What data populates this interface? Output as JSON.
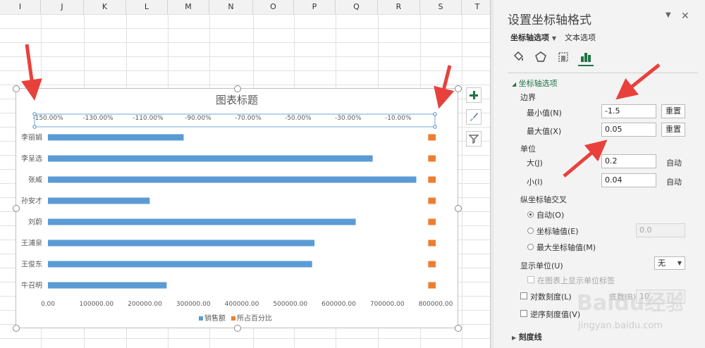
{
  "sheet": {
    "columns": [
      "I",
      "J",
      "K",
      "L",
      "M",
      "N",
      "O",
      "P",
      "Q",
      "R",
      "S",
      "T"
    ]
  },
  "chart": {
    "colors": {
      "sales": "#5b9bd5",
      "percent": "#ed7d31"
    }
  },
  "chart_data": {
    "type": "bar",
    "title": "图表标题",
    "categories": [
      "李丽娟",
      "李呈选",
      "张威",
      "孙安才",
      "刘蔚",
      "王浦泉",
      "王俊东",
      "牛召明"
    ],
    "series": [
      {
        "name": "销售额",
        "axis": "bottom",
        "values": [
          280000,
          670000,
          760000,
          210000,
          635000,
          550000,
          545000,
          245000
        ]
      },
      {
        "name": "所占百分比",
        "axis": "top",
        "values": [
          0.03,
          0.03,
          0.03,
          0.03,
          0.03,
          0.03,
          0.03,
          0.03
        ]
      }
    ],
    "bottom_axis": {
      "range": [
        0,
        800000
      ],
      "tick_labels": [
        "0.00",
        "100000.00",
        "200000.00",
        "300000.00",
        "400000.00",
        "500000.00",
        "600000.00",
        "700000.00",
        "800000.00"
      ]
    },
    "top_axis": {
      "range": [
        -1.5,
        0.05
      ],
      "tick_labels": [
        "-150.00%",
        "-130.00%",
        "-110.00%",
        "-90.00%",
        "-70.00%",
        "-50.00%",
        "-30.00%",
        "-10.00%"
      ]
    },
    "legend_position": "bottom",
    "legend": [
      "销售额",
      "所占百分比"
    ],
    "grid": false
  },
  "pane": {
    "title": "设置坐标轴格式",
    "tabs": {
      "axis_options": "坐标轴选项",
      "text_options": "文本选项"
    },
    "section": "坐标轴选项",
    "bounds": {
      "label": "边界",
      "min_label": "最小值(N)",
      "min_value": "-1.5",
      "max_label": "最大值(X)",
      "max_value": "0.05",
      "reset": "重置"
    },
    "units": {
      "label": "单位",
      "major_label": "大(J)",
      "major_value": "0.2",
      "minor_label": "小(I)",
      "minor_value": "0.04",
      "auto": "自动"
    },
    "cross": {
      "label": "纵坐标轴交叉",
      "auto": "自动(O)",
      "axis_value": "坐标轴值(E)",
      "axis_value_input": "0.0",
      "max_value": "最大坐标轴值(M)"
    },
    "display_units": {
      "label": "显示单位(U)",
      "value": "无",
      "show_label": "在图表上显示单位标签"
    },
    "log_scale_label": "对数刻度(L)",
    "base_label": "底数(B)",
    "base_value": "10",
    "reverse_label": "逆序刻度值(V)",
    "tick_marks": "刻度线"
  },
  "watermark": {
    "brand": "Baidu经验",
    "url": "jingyan.baidu.com"
  },
  "annotation_color": "#e8413c"
}
